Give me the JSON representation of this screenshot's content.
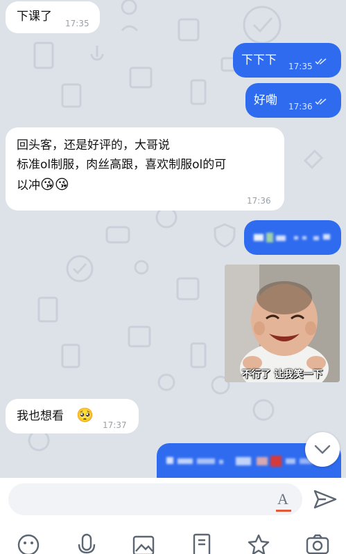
{
  "messages": [
    {
      "side": "in",
      "text": "下课了",
      "time": "17:35"
    },
    {
      "side": "out",
      "text": "下下下",
      "time": "17:35"
    },
    {
      "side": "out",
      "text": "好嘞",
      "time": "17:36"
    },
    {
      "side": "in",
      "lines": [
        "回头客，还是好评的，大哥说",
        "标准ol制服，肉丝高跟，喜欢制服ol的可",
        "以冲"
      ],
      "emoji": "😘😘",
      "time": "17:36"
    },
    {
      "side": "out",
      "text": "[blurred]"
    },
    {
      "side": "out",
      "sticker_caption": "不行了 让我笑一下"
    },
    {
      "side": "in",
      "text": "我也想看",
      "emoji": "🥺",
      "time": "17:37"
    },
    {
      "side": "out",
      "text": "[blurred]"
    }
  ],
  "composer": {
    "placeholder": "",
    "format_icon": "A"
  },
  "icons": {
    "read": "double-check-icon",
    "scroll": "chevron-down-icon",
    "send": "send-icon",
    "toolbar": [
      "emoji-icon",
      "microphone-icon",
      "image-icon",
      "document-icon",
      "star-icon",
      "camera-icon"
    ]
  },
  "colors": {
    "accent": "#2f6bef",
    "wallpaper": "#dde2e9",
    "incoming": "#ffffff"
  }
}
